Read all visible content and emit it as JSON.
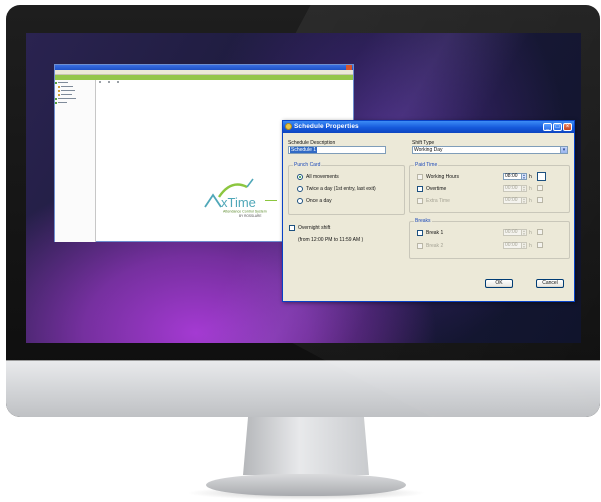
{
  "app": {
    "logo_text": "AxTime",
    "logo_tagline": "Attendance Control System",
    "logo_by": "BY ROSSLARE"
  },
  "dialog": {
    "title": "Schedule Properties",
    "schedule_description_label": "Schedule Description",
    "schedule_description_value": "Schedule 1",
    "shift_type_label": "Shift Type",
    "shift_type_value": "Working Day",
    "punch_card": {
      "title": "Punch Card",
      "options": [
        {
          "label": "All movements",
          "checked": true
        },
        {
          "label": "Twice a day (1st entry, last exit)",
          "checked": false
        },
        {
          "label": "Once a day",
          "checked": false
        }
      ]
    },
    "overnight_shift_label": "Overnight shift",
    "overnight_note": "(from 12:00 PM to 11:59 AM )",
    "paid_time": {
      "title": "Paid Time",
      "rows": [
        {
          "label": "Working Hours",
          "value": "08:00",
          "unit": "h",
          "enabled": true
        },
        {
          "label": "Overtime",
          "value": "00:00",
          "unit": "h",
          "enabled": false
        },
        {
          "label": "Extra Time",
          "value": "00:00",
          "unit": "h",
          "enabled": false
        }
      ]
    },
    "breaks": {
      "title": "Breaks",
      "rows": [
        {
          "label": "Break 1",
          "value": "00:00",
          "unit": "h",
          "enabled": false
        },
        {
          "label": "Break 2",
          "value": "00:00",
          "unit": "h",
          "enabled": false
        }
      ]
    },
    "ok_label": "OK",
    "cancel_label": "Cancel"
  },
  "colors": {
    "titlebar": "#1559dc",
    "dialog_bg": "#ece9d8",
    "accent_green": "#94c64a",
    "logo_teal": "#4fa7b8",
    "logo_green": "#8cc63f"
  }
}
